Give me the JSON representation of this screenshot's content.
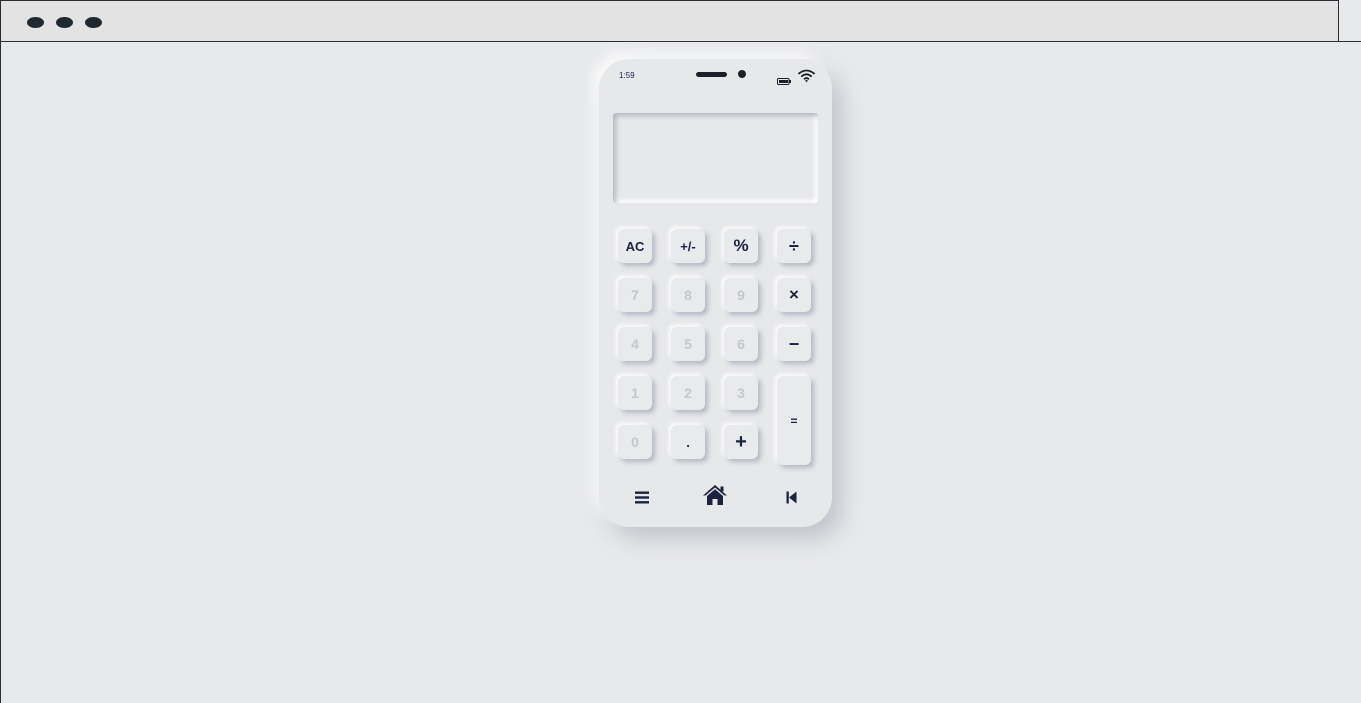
{
  "status_bar": {
    "time": "1:59",
    "battery_icon": "battery-icon",
    "wifi_icon": "wifi-icon"
  },
  "display": {
    "value": ""
  },
  "keypad": {
    "row1": [
      "AC",
      "+/-",
      "%",
      "÷"
    ],
    "row2": [
      "7",
      "8",
      "9",
      "×"
    ],
    "row3": [
      "4",
      "5",
      "6",
      "−"
    ],
    "row4": [
      "1",
      "2",
      "3"
    ],
    "row5": [
      "0",
      ".",
      "+"
    ],
    "equals": "="
  },
  "nav": {
    "menu_icon": "menu-icon",
    "home_icon": "home-icon",
    "back_icon": "skip-back-icon"
  },
  "colors": {
    "background": "#e8e9eb",
    "accent": "#1c2340",
    "number_text": "#c6c7cb"
  }
}
